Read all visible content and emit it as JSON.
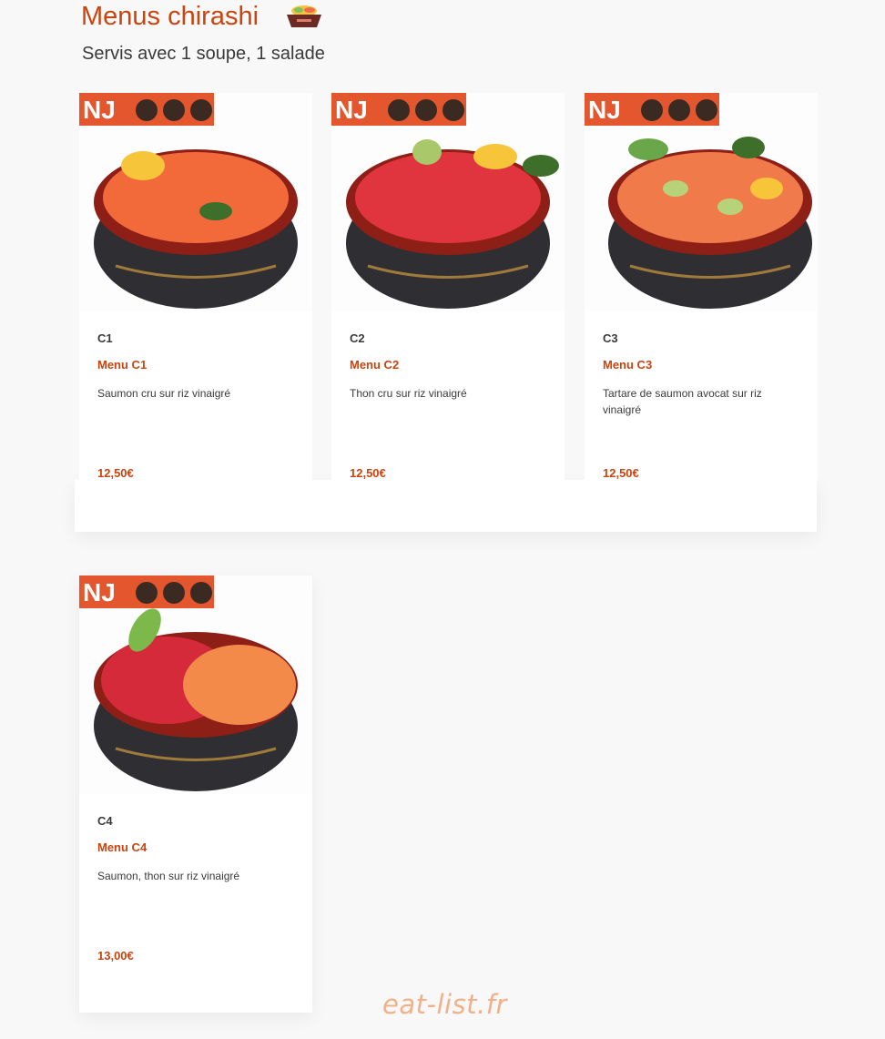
{
  "section": {
    "title": "Menus chirashi",
    "subtitle": "Servis avec 1 soupe, 1 salade"
  },
  "badge": {
    "logo_text": "NJ"
  },
  "items": [
    {
      "code": "C1",
      "name": "Menu C1",
      "description": "Saumon cru sur riz vinaigré",
      "price": "12,50€",
      "fish": "#f26a3a"
    },
    {
      "code": "C2",
      "name": "Menu C2",
      "description": "Thon cru sur riz vinaigré",
      "price": "12,50€",
      "fish": "#e0343f"
    },
    {
      "code": "C3",
      "name": "Menu C3",
      "description": "Tartare de saumon avocat sur riz vinaigré",
      "price": "12,50€",
      "fish": "#f07a4a"
    },
    {
      "code": "C4",
      "name": "Menu C4",
      "description": "Saumon, thon sur riz vinaigré",
      "price": "13,00€",
      "fish": "#ec5a3a"
    }
  ],
  "watermark": "eat-list.fr",
  "colors": {
    "accent": "#c9440f",
    "text": "#3a3a3a",
    "background": "#f8f8f8"
  }
}
